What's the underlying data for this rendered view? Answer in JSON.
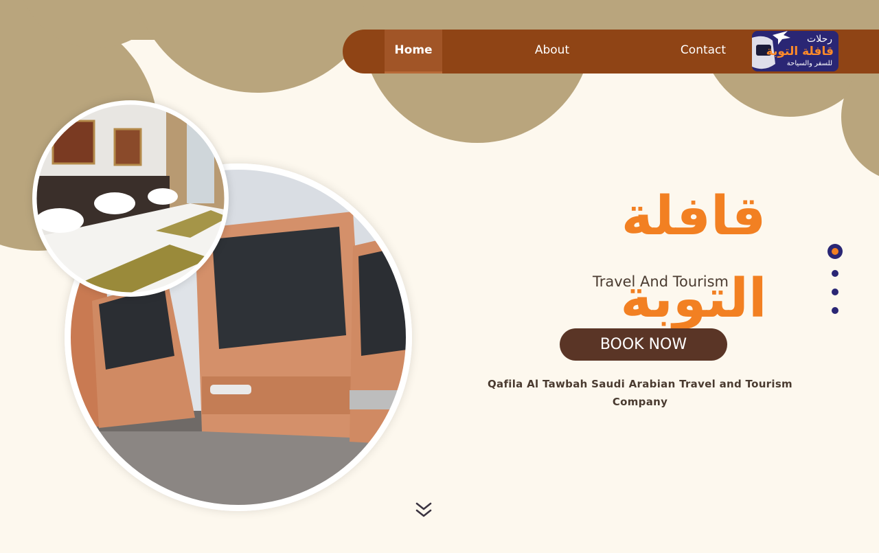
{
  "nav": {
    "home": "Home",
    "about": "About",
    "contact": "Contact"
  },
  "logo": {
    "top": "رحلات",
    "main": "قافلة التوبة",
    "sub": "للسفر والسياحة"
  },
  "hero": {
    "brand_arabic": "قافلة التوبة",
    "tagline": "Travel And Tourism",
    "book_button": "BOOK NOW",
    "description": "Qafila Al Tawbah Saudi Arabian Travel and Tourism Company"
  },
  "slider": {
    "total_slides": 4,
    "active_slide": 1
  },
  "images": {
    "bus_photo": "bus-fleet-photo",
    "room_photo": "hotel-room-photo"
  },
  "icons": {
    "scroll": "chevron-double-down-icon"
  },
  "colors": {
    "background": "#fdf8ee",
    "shapes": "#b9a57d",
    "navbar": "#8f4415",
    "accent_orange": "#f28022",
    "button": "#5a3526",
    "dots": "#2a2674"
  }
}
